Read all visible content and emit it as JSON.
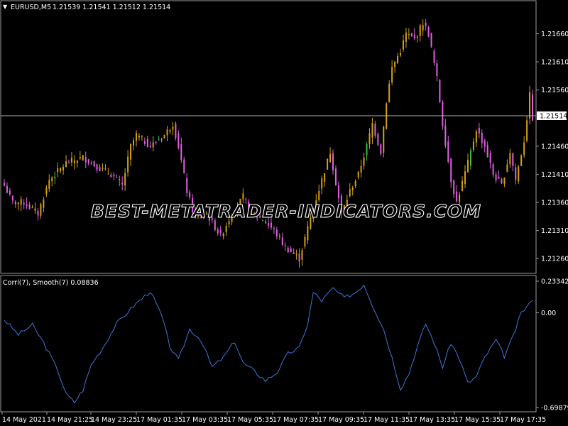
{
  "header": {
    "symbol": "EURUSD,M5",
    "ohlc": "1.21539 1.21541 1.21512 1.21514",
    "collapse_glyph": "▼"
  },
  "watermark": "BEST-METATRADER-INDICATORS.COM",
  "price_panel": {
    "ticks": [
      "1.21660",
      "1.21610",
      "1.21560",
      "1.21460",
      "1.21410",
      "1.21360",
      "1.21310",
      "1.21260"
    ],
    "current_price": "1.21514",
    "up_color": "#d4a017",
    "down_color": "#e060e0",
    "accent_color": "#3fbf3f"
  },
  "indicator_panel": {
    "title": "Corrl(7), Smooth(7) 0.08836",
    "ticks": [
      "0.23342",
      "0.00",
      "-0.69879"
    ],
    "line_color": "#3c78d8"
  },
  "time_axis": {
    "labels": [
      "14 May 2021",
      "14 May 21:25",
      "14 May 23:25",
      "17 May 01:35",
      "17 May 03:35",
      "17 May 05:35",
      "17 May 07:35",
      "17 May 09:35",
      "17 May 11:35",
      "17 May 13:35",
      "17 May 15:35",
      "17 May 17:35"
    ]
  },
  "chart_data": [
    {
      "type": "candlestick",
      "title": "EURUSD,M5",
      "ylim": [
        1.2124,
        1.2171
      ],
      "close_anchors": [
        [
          0,
          1.2139
        ],
        [
          3,
          1.2136
        ],
        [
          7,
          1.2136
        ],
        [
          12,
          1.2134
        ],
        [
          16,
          1.214
        ],
        [
          22,
          1.2143
        ],
        [
          28,
          1.2144
        ],
        [
          34,
          1.2142
        ],
        [
          38,
          1.2141
        ],
        [
          42,
          1.2139
        ],
        [
          45,
          1.2146
        ],
        [
          47,
          1.2148
        ],
        [
          52,
          1.2146
        ],
        [
          57,
          1.2148
        ],
        [
          60,
          1.215
        ],
        [
          62,
          1.2146
        ],
        [
          65,
          1.2138
        ],
        [
          68,
          1.2133
        ],
        [
          72,
          1.2134
        ],
        [
          77,
          1.213
        ],
        [
          80,
          1.2133
        ],
        [
          85,
          1.2137
        ],
        [
          88,
          1.2134
        ],
        [
          92,
          1.2133
        ],
        [
          96,
          1.2131
        ],
        [
          100,
          1.2128
        ],
        [
          105,
          1.2126
        ],
        [
          110,
          1.2135
        ],
        [
          113,
          1.214
        ],
        [
          116,
          1.2145
        ],
        [
          120,
          1.2134
        ],
        [
          123,
          1.2138
        ],
        [
          126,
          1.2141
        ],
        [
          129,
          1.2146
        ],
        [
          131,
          1.215
        ],
        [
          134,
          1.2145
        ],
        [
          136,
          1.2154
        ],
        [
          138,
          1.216
        ],
        [
          141,
          1.2163
        ],
        [
          143,
          1.2166
        ],
        [
          146,
          1.2165
        ],
        [
          149,
          1.2168
        ],
        [
          151,
          1.2166
        ],
        [
          154,
          1.2158
        ],
        [
          156,
          1.215
        ],
        [
          159,
          1.214
        ],
        [
          161,
          1.2136
        ],
        [
          165,
          1.2143
        ],
        [
          168,
          1.2149
        ],
        [
          171,
          1.2146
        ],
        [
          174,
          1.2141
        ],
        [
          177,
          1.2139
        ],
        [
          180,
          1.2145
        ],
        [
          182,
          1.214
        ],
        [
          185,
          1.2147
        ],
        [
          187,
          1.2155
        ],
        [
          188,
          1.2151
        ]
      ]
    },
    {
      "type": "line",
      "title": "Corrl(7), Smooth(7)",
      "ylim": [
        -0.69879,
        0.23342
      ],
      "x": [
        0,
        5,
        10,
        14,
        19,
        22,
        25,
        28,
        31,
        35,
        40,
        46,
        52,
        56,
        59,
        62,
        66,
        70,
        74,
        78,
        82,
        85,
        89,
        93,
        97,
        101,
        105,
        108,
        110,
        113,
        117,
        121,
        125,
        128,
        131,
        135,
        138,
        141,
        144,
        147,
        150,
        153,
        156,
        159,
        162,
        165,
        168,
        171,
        175,
        178,
        181,
        184,
        188
      ],
      "y": [
        -0.05,
        -0.16,
        -0.09,
        -0.22,
        -0.42,
        -0.6,
        -0.66,
        -0.57,
        -0.38,
        -0.26,
        -0.08,
        0.05,
        0.16,
        -0.02,
        -0.25,
        -0.35,
        -0.12,
        -0.2,
        -0.4,
        -0.33,
        -0.21,
        -0.37,
        -0.43,
        -0.5,
        -0.44,
        -0.3,
        -0.26,
        -0.08,
        0.15,
        0.09,
        0.18,
        0.11,
        0.15,
        0.21,
        0.06,
        -0.12,
        -0.33,
        -0.56,
        -0.45,
        -0.25,
        -0.08,
        -0.22,
        -0.4,
        -0.22,
        -0.34,
        -0.52,
        -0.47,
        -0.33,
        -0.2,
        -0.32,
        -0.18,
        0.0,
        0.09
      ]
    }
  ]
}
